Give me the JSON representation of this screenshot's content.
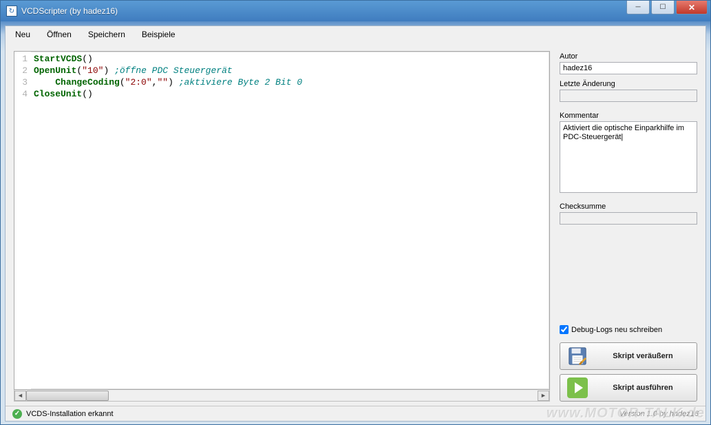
{
  "window": {
    "title": "VCDScripter (by hadez16)"
  },
  "menu": {
    "new": "Neu",
    "open": "Öffnen",
    "save": "Speichern",
    "examples": "Beispiele"
  },
  "editor": {
    "lines": [
      "1",
      "2",
      "3",
      "4"
    ],
    "code_tokens": [
      [
        {
          "t": "fn",
          "v": "StartVCDS"
        },
        {
          "t": "p",
          "v": "()"
        }
      ],
      [
        {
          "t": "fn",
          "v": "OpenUnit"
        },
        {
          "t": "p",
          "v": "("
        },
        {
          "t": "str",
          "v": "\"10\""
        },
        {
          "t": "p",
          "v": ") "
        },
        {
          "t": "cmt",
          "v": ";öffne PDC Steuergerät"
        }
      ],
      [
        {
          "t": "p",
          "v": "    "
        },
        {
          "t": "fn",
          "v": "ChangeCoding"
        },
        {
          "t": "p",
          "v": "("
        },
        {
          "t": "str",
          "v": "\"2:0\""
        },
        {
          "t": "p",
          "v": ","
        },
        {
          "t": "str",
          "v": "\"\""
        },
        {
          "t": "p",
          "v": ") "
        },
        {
          "t": "cmt",
          "v": ";aktiviere Byte 2 Bit 0"
        }
      ],
      [
        {
          "t": "fn",
          "v": "CloseUnit"
        },
        {
          "t": "p",
          "v": "()"
        }
      ]
    ]
  },
  "side": {
    "author_label": "Autor",
    "author_value": "hadez16",
    "lastchange_label": "Letzte Änderung",
    "lastchange_value": "",
    "comment_label": "Kommentar",
    "comment_value": "Aktiviert die optische Einparkhilfe im PDC-Steuergerät|",
    "checksum_label": "Checksumme",
    "checksum_value": "",
    "debug_label": "Debug-Logs neu schreiben",
    "debug_checked": true,
    "btn_save": "Skript veräußern",
    "btn_run": "Skript ausführen"
  },
  "status": {
    "text": "VCDS-Installation erkannt",
    "version": "Version 1.0 by hadez16"
  },
  "watermark": "www.MOTOR-TALK.de"
}
